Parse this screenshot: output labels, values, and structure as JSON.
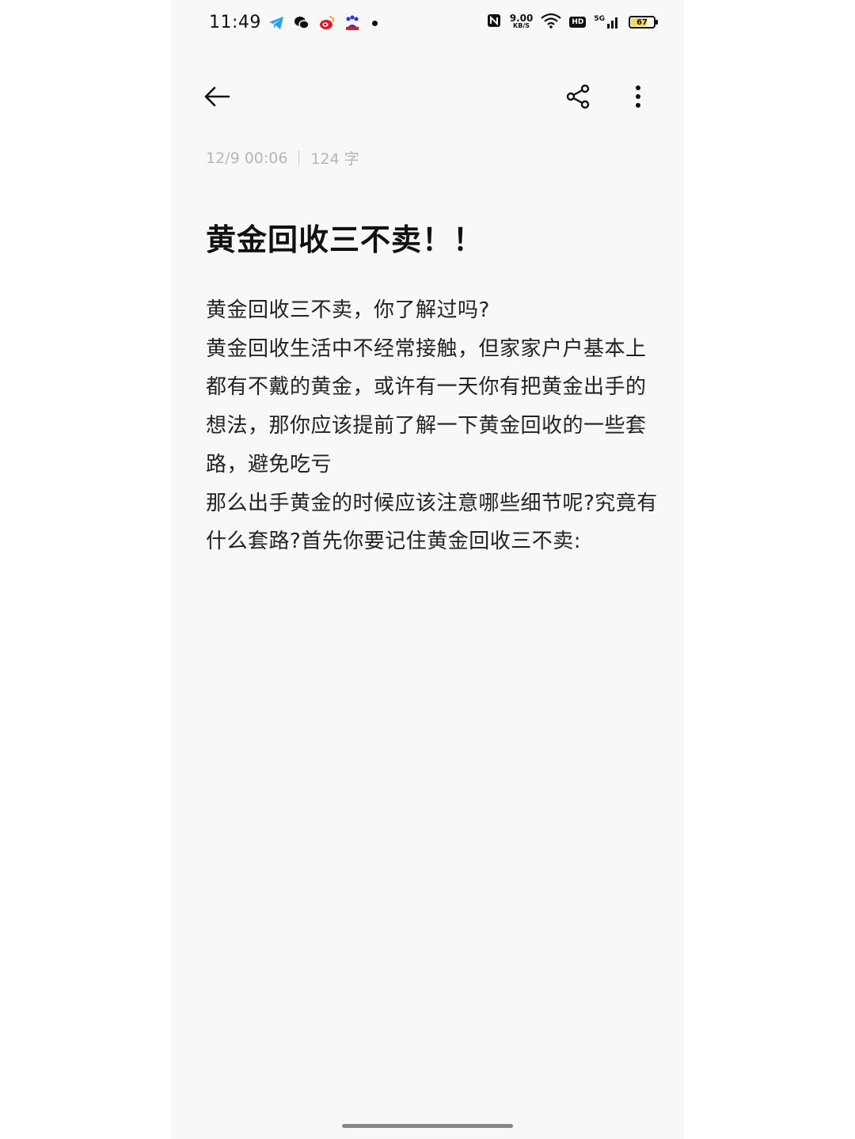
{
  "status_bar": {
    "time": "11:49",
    "notifications": [
      "telegram-icon",
      "wechat-icon",
      "weibo-icon",
      "baidu-icon"
    ],
    "network_speed": "9.00",
    "network_speed_unit": "KB/S",
    "hd_label": "HD",
    "signal_label": "5G",
    "battery_level": "67"
  },
  "toolbar": {
    "back_icon": "arrow-left-icon",
    "share_icon": "share-icon",
    "more_icon": "more-vertical-icon"
  },
  "note": {
    "date": "12/9 00:06",
    "word_count": "124 字",
    "title": "黄金回收三不卖！！",
    "paragraphs": [
      "黄金回收三不卖，你了解过吗?",
      "黄金回收生活中不经常接触，但家家户户基本上都有不戴的黄金，或许有一天你有把黄金出手的想法，那你应该提前了解一下黄金回收的一些套路，避免吃亏",
      "那么出手黄金的时候应该注意哪些细节呢?究竟有什么套路?首先你要记住黄金回收三不卖:"
    ]
  },
  "colors": {
    "background": "#f8f8f8",
    "text": "#222222",
    "meta_text": "#b5b5b5",
    "battery_fill": "#f3d85a"
  }
}
